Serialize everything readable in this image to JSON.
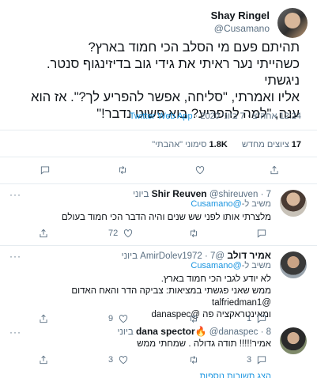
{
  "tweet": {
    "name": "Shay Ringel",
    "handle": "@Cusamano",
    "text_lines": [
      "תהיתם פעם מי הסלב הכי חמוד בארץ?",
      "כשהייתי נער ראיתי את גידי גוב בדיזינגוף סנטר. ניגשתי",
      "אליו ואמרתי, \"סליחה, אפשר להפריע לך?\". אז הוא",
      "ענה, \"למה להפריע? בוא פשוט נדבר!\""
    ],
    "time": "12:24 אחה\"צ · 7 ביוני 2020",
    "source": "Twitter Web App",
    "retweets_count": "17",
    "retweets_label": "ציוצים מחדש",
    "likes_count": "1.8K",
    "likes_label": "סימוני \"אהבתי\""
  },
  "main_actions": [
    "reply-icon",
    "retweet-icon",
    "like-icon",
    "share-icon"
  ],
  "replies": [
    {
      "name": "Shir Reuven",
      "handle": "@shireuven",
      "date": "7 ביוני",
      "replying_label": "משיב ל-",
      "replying_to": "@Cusamano",
      "lines": [
        "מלצרתי אותו לפני שש שנים והיה הדבר הכי חמוד בעולם"
      ],
      "like_count": "72",
      "retweet_count": "",
      "reply_count": ""
    },
    {
      "name": "אמיר דולב",
      "handle": "@AmirDolev1972",
      "date": "7 ביוני",
      "replying_label": "משיב ל-",
      "replying_to": "@Cusamano",
      "lines": [
        "לא יודע לגבי הכי חמוד בארץ.",
        "ממש שאני פגשתי במציאות: צביקה הדר והאח האדום @talfriedman1",
        "ומאינטראקציה פה @danaspec"
      ],
      "like_count": "9",
      "retweet_count": "",
      "reply_count": "1"
    },
    {
      "name": "dana spector🔥",
      "handle": "@danaspec",
      "date": "8 ביוני",
      "replying_label": "",
      "replying_to": "",
      "lines": [
        "אמיר!!!!! תודה גדולה . שמחתי ממש"
      ],
      "like_count": "3",
      "retweet_count": "",
      "reply_count": "3"
    }
  ],
  "show_more": "הצג תשובות נוספות"
}
